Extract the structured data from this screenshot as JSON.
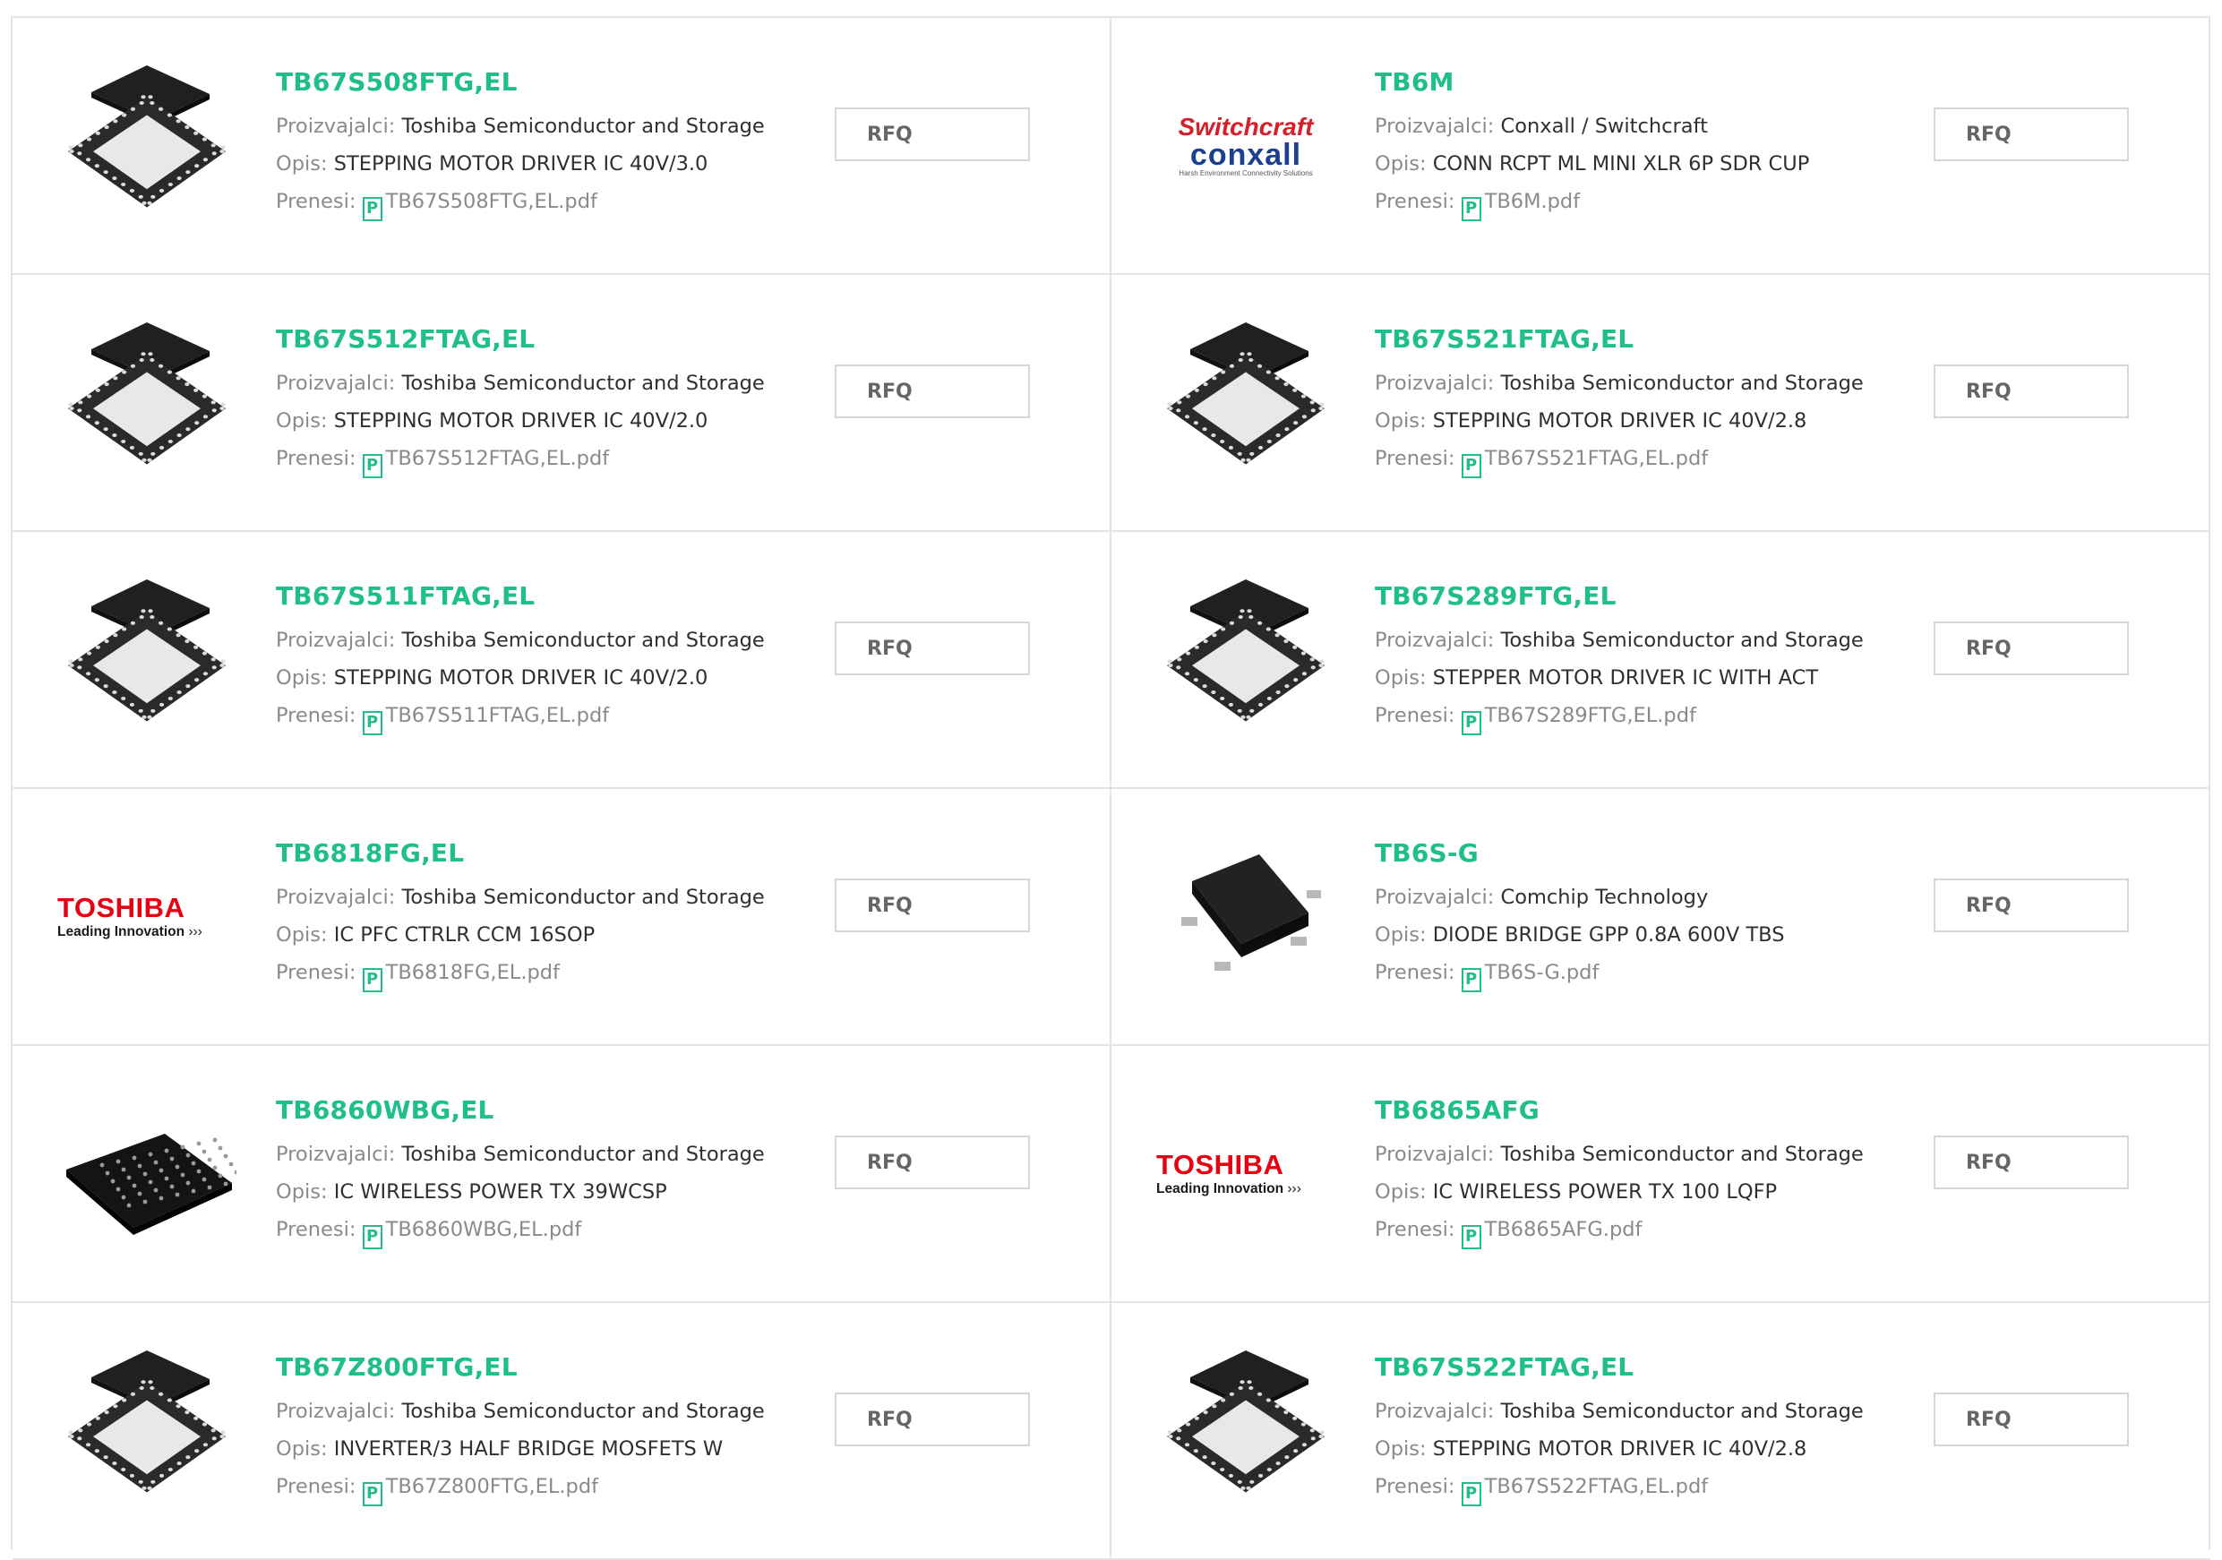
{
  "labels": {
    "manufacturer": "Proizvajalci:",
    "description": "Opis:",
    "download": "Prenesi:",
    "rfq": "RFQ",
    "pdf_icon_glyph": "P"
  },
  "products": [
    {
      "part_number": "TB67S508FTG,EL",
      "manufacturer": "Toshiba Semiconductor and Storage",
      "description": "STEPPING MOTOR DRIVER IC 40V/3.0",
      "datasheet": "TB67S508FTG,EL.pdf",
      "image": "qfn-chip-stack"
    },
    {
      "part_number": "TB6M",
      "manufacturer": "Conxall / Switchcraft",
      "description": "CONN RCPT ML MINI XLR 6P SDR CUP",
      "datasheet": "TB6M.pdf",
      "image": "switchcraft-conxall-logo"
    },
    {
      "part_number": "TB67S512FTAG,EL",
      "manufacturer": "Toshiba Semiconductor and Storage",
      "description": "STEPPING MOTOR DRIVER IC 40V/2.0",
      "datasheet": "TB67S512FTAG,EL.pdf",
      "image": "qfn-chip-stack"
    },
    {
      "part_number": "TB67S521FTAG,EL",
      "manufacturer": "Toshiba Semiconductor and Storage",
      "description": "STEPPING MOTOR DRIVER IC 40V/2.8",
      "datasheet": "TB67S521FTAG,EL.pdf",
      "image": "qfn-chip-stack"
    },
    {
      "part_number": "TB67S511FTAG,EL",
      "manufacturer": "Toshiba Semiconductor and Storage",
      "description": "STEPPING MOTOR DRIVER IC 40V/2.0",
      "datasheet": "TB67S511FTAG,EL.pdf",
      "image": "qfn-chip-stack"
    },
    {
      "part_number": "TB67S289FTG,EL",
      "manufacturer": "Toshiba Semiconductor and Storage",
      "description": "STEPPER MOTOR DRIVER IC WITH ACT",
      "datasheet": "TB67S289FTG,EL.pdf",
      "image": "qfn-chip-stack"
    },
    {
      "part_number": "TB6818FG,EL",
      "manufacturer": "Toshiba Semiconductor and Storage",
      "description": "IC PFC CTRLR CCM 16SOP",
      "datasheet": "TB6818FG,EL.pdf",
      "image": "toshiba-logo"
    },
    {
      "part_number": "TB6S-G",
      "manufacturer": "Comchip Technology",
      "description": "DIODE BRIDGE GPP 0.8A 600V TBS",
      "datasheet": "TB6S-G.pdf",
      "image": "bridge-rectifier-chip"
    },
    {
      "part_number": "TB6860WBG,EL",
      "manufacturer": "Toshiba Semiconductor and Storage",
      "description": "IC WIRELESS POWER TX 39WCSP",
      "datasheet": "TB6860WBG,EL.pdf",
      "image": "wcsp-chip"
    },
    {
      "part_number": "TB6865AFG",
      "manufacturer": "Toshiba Semiconductor and Storage",
      "description": "IC WIRELESS POWER TX 100 LQFP",
      "datasheet": "TB6865AFG.pdf",
      "image": "toshiba-logo"
    },
    {
      "part_number": "TB67Z800FTG,EL",
      "manufacturer": "Toshiba Semiconductor and Storage",
      "description": "INVERTER/3 HALF BRIDGE MOSFETS W",
      "datasheet": "TB67Z800FTG,EL.pdf",
      "image": "qfn-chip-stack"
    },
    {
      "part_number": "TB67S522FTAG,EL",
      "manufacturer": "Toshiba Semiconductor and Storage",
      "description": "STEPPING MOTOR DRIVER IC 40V/2.8",
      "datasheet": "TB67S522FTAG,EL.pdf",
      "image": "qfn-chip-stack"
    }
  ],
  "brand_logos": {
    "toshiba": {
      "name": "TOSHIBA",
      "tagline": "Leading Innovation",
      "chevrons": "›››"
    },
    "switchcraft": {
      "name": "Switchcraft",
      "sub": "conxall",
      "tagline": "Harsh Environment Connectivity Solutions"
    }
  },
  "colors": {
    "part_number": "#1fbe8c",
    "label": "#8a8a8a",
    "value": "#2f2f2f",
    "border": "#e4e4e4",
    "rfq_text": "#666666",
    "toshiba_red": "#e60012",
    "switchcraft_red": "#d4202a",
    "conxall_blue": "#1d3f8f"
  }
}
